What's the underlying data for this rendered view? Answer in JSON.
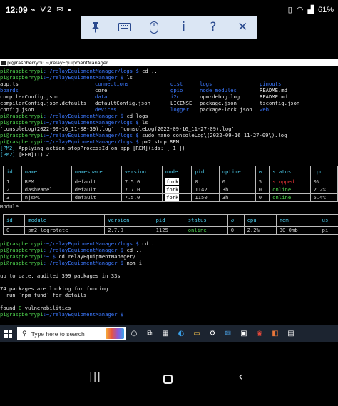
{
  "status_bar": {
    "time": "12:09",
    "left_icons": "⌁ V2 ✉ ▪",
    "battery": "61%",
    "icons": [
      "vibrate-icon",
      "wifi-icon",
      "signal-icon",
      "battery-icon"
    ]
  },
  "rd_toolbar": {
    "pin": "📌",
    "keyboard": "⌨",
    "mouse": "🖱",
    "info": "i",
    "help": "?",
    "close": "✕"
  },
  "terminal": {
    "title": "pi@raspberrypi: ~/relayEquipmentManager",
    "lines": [
      {
        "user": "pi@raspberrypi",
        "path": ":~/relayEquipmentManager/logs $ ",
        "cmd": "cd .."
      },
      {
        "user": "pi@raspberrypi",
        "path": ":~/relayEquipmentManager $ ",
        "cmd": "ls"
      },
      {
        "cols": [
          [
            "app.ts",
            "w"
          ],
          [
            "connections",
            "b"
          ],
          [
            "dist",
            "b"
          ],
          [
            "logs",
            "b"
          ],
          [
            "pinouts",
            "b"
          ]
        ]
      },
      {
        "cols": [
          [
            "boards",
            "b"
          ],
          [
            "core",
            "w"
          ],
          [
            "gpio",
            "b"
          ],
          [
            "node_modules",
            "b"
          ],
          [
            "README.md",
            "w"
          ]
        ]
      },
      {
        "cols": [
          [
            "compilerConfig.json",
            "w"
          ],
          [
            "data",
            "b"
          ],
          [
            "i2c",
            "b"
          ],
          [
            "npm-debug.log",
            "w"
          ],
          [
            "README.md",
            "w"
          ]
        ]
      },
      {
        "cols": [
          [
            "compilerConfig.json.defaults",
            "w"
          ],
          [
            "defaultConfig.json",
            "w"
          ],
          [
            "LICENSE",
            "w"
          ],
          [
            "package.json",
            "w"
          ],
          [
            "tsconfig.json",
            "w"
          ]
        ]
      },
      {
        "cols": [
          [
            "config.json",
            "w"
          ],
          [
            "devices",
            "b"
          ],
          [
            "logger",
            "b"
          ],
          [
            "package-lock.json",
            "w"
          ],
          [
            "web",
            "b"
          ]
        ]
      },
      {
        "user": "pi@raspberrypi",
        "path": ":~/relayEquipmentManager $ ",
        "cmd": "cd logs"
      },
      {
        "user": "pi@raspberrypi",
        "path": ":~/relayEquipmentManager/logs $ ",
        "cmd": "ls"
      },
      {
        "plain": "'consoleLog(2022-09-16_11-08-39).log'  'consoleLog(2022-09-16_11-27-09).log'"
      },
      {
        "user": "pi@raspberrypi",
        "path": ":~/relayEquipmentManager/logs $ ",
        "cmd": "sudo nano consoleLog\\(2022-09-16_11-27-09\\).log"
      },
      {
        "user": "pi@raspberrypi",
        "path": ":~/relayEquipmentManager/logs $ ",
        "cmd": "pm2 stop REM"
      },
      {
        "tag": "[PM2]",
        "plain": " Applying action stopProcessId on app [REM](ids: [ 1 ])"
      },
      {
        "tag": "[PM2]",
        "plain": " [REM](1) ✓"
      }
    ],
    "pm2_table": {
      "headers": [
        "id",
        "name",
        "namespace",
        "version",
        "mode",
        "pid",
        "uptime",
        "↺",
        "status",
        "cpu"
      ],
      "rows": [
        [
          "1",
          "REM",
          "default",
          "7.5.0",
          "fork",
          "0",
          "0",
          "5",
          "stopped",
          "0%"
        ],
        [
          "2",
          "dashPanel",
          "default",
          "7.7.0",
          "fork",
          "1142",
          "3h",
          "0",
          "online",
          "2.2%"
        ],
        [
          "3",
          "njsPC",
          "default",
          "7.5.0",
          "fork",
          "1150",
          "3h",
          "0",
          "online",
          "5.4%"
        ]
      ]
    },
    "module_label": "Module",
    "module_table": {
      "headers": [
        "id",
        "module",
        "version",
        "pid",
        "status",
        "↺",
        "cpu",
        "mem",
        "us"
      ],
      "rows": [
        [
          "0",
          "pm2-logrotate",
          "2.7.0",
          "1125",
          "online",
          "0",
          "2.2%",
          "30.0mb",
          "pi"
        ]
      ]
    },
    "after_lines": [
      {
        "user": "pi@raspberrypi",
        "path": ":~/relayEquipmentManager/logs $ ",
        "cmd": "cd .."
      },
      {
        "user": "pi@raspberrypi",
        "path": ":~/relayEquipmentManager $ ",
        "cmd": "cd .."
      },
      {
        "user": "pi@raspberrypi",
        "path": ":~ $ ",
        "cmd": "cd relayEquipmentManager/"
      },
      {
        "user": "pi@raspberrypi",
        "path": ":~/relayEquipmentManager $ ",
        "cmd": "npm i"
      },
      {
        "plain": ""
      },
      {
        "plain": "up to date, audited 399 packages in 33s"
      },
      {
        "plain": ""
      },
      {
        "plain": "74 packages are looking for funding"
      },
      {
        "plain": "  run `npm fund` for details"
      },
      {
        "plain": ""
      },
      {
        "plain": "found ",
        "zero": "0",
        "rest": " vulnerabilities"
      },
      {
        "user": "pi@raspberrypi",
        "path": ":~/relayEquipmentManager $ ",
        "cmd": ""
      }
    ]
  },
  "taskbar": {
    "search_placeholder": "Type here to search",
    "apps": [
      {
        "name": "cortana-icon",
        "glyph": "○"
      },
      {
        "name": "task-view-icon",
        "glyph": "⧉"
      },
      {
        "name": "widgets-icon",
        "glyph": "▦"
      },
      {
        "name": "edge-icon",
        "glyph": "◐"
      },
      {
        "name": "file-explorer-icon",
        "glyph": "▭"
      },
      {
        "name": "settings-icon",
        "glyph": "⚙"
      },
      {
        "name": "mail-icon",
        "glyph": "✉"
      },
      {
        "name": "photos-icon",
        "glyph": "▣"
      },
      {
        "name": "chrome-icon",
        "glyph": "◉"
      },
      {
        "name": "office-icon",
        "glyph": "◧"
      },
      {
        "name": "terminal-icon",
        "glyph": "▤"
      }
    ]
  },
  "android_nav": {
    "recent": "|||",
    "back": "‹"
  }
}
